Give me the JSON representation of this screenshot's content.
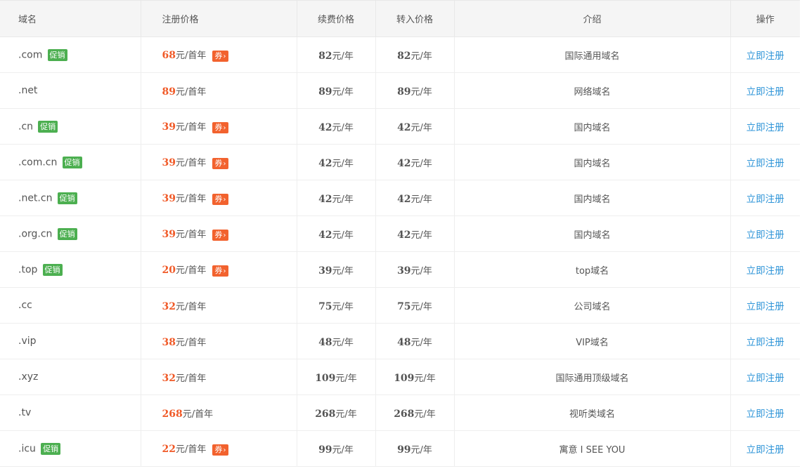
{
  "header": {
    "domain": "域名",
    "register_price": "注册价格",
    "renew_price": "续费价格",
    "transfer_price": "转入价格",
    "intro": "介绍",
    "action": "操作"
  },
  "labels": {
    "promo": "促销",
    "coupon": "券",
    "coupon_arrow": "›",
    "first_year_unit": "元/首年",
    "year_unit": "元/年",
    "register_now": "立即注册"
  },
  "rows": [
    {
      "domain": ".com",
      "promo": true,
      "reg": "68",
      "coupon": true,
      "renew": "82",
      "transfer": "82",
      "desc": "国际通用域名"
    },
    {
      "domain": ".net",
      "promo": false,
      "reg": "89",
      "coupon": false,
      "renew": "89",
      "transfer": "89",
      "desc": "网络域名"
    },
    {
      "domain": ".cn",
      "promo": true,
      "reg": "39",
      "coupon": true,
      "renew": "42",
      "transfer": "42",
      "desc": "国内域名"
    },
    {
      "domain": ".com.cn",
      "promo": true,
      "reg": "39",
      "coupon": true,
      "renew": "42",
      "transfer": "42",
      "desc": "国内域名"
    },
    {
      "domain": ".net.cn",
      "promo": true,
      "reg": "39",
      "coupon": true,
      "renew": "42",
      "transfer": "42",
      "desc": "国内域名"
    },
    {
      "domain": ".org.cn",
      "promo": true,
      "reg": "39",
      "coupon": true,
      "renew": "42",
      "transfer": "42",
      "desc": "国内域名"
    },
    {
      "domain": ".top",
      "promo": true,
      "reg": "20",
      "coupon": true,
      "renew": "39",
      "transfer": "39",
      "desc": "top域名"
    },
    {
      "domain": ".cc",
      "promo": false,
      "reg": "32",
      "coupon": false,
      "renew": "75",
      "transfer": "75",
      "desc": "公司域名"
    },
    {
      "domain": ".vip",
      "promo": false,
      "reg": "38",
      "coupon": false,
      "renew": "48",
      "transfer": "48",
      "desc": "VIP域名"
    },
    {
      "domain": ".xyz",
      "promo": false,
      "reg": "32",
      "coupon": false,
      "renew": "109",
      "transfer": "109",
      "desc": "国际通用顶级域名"
    },
    {
      "domain": ".tv",
      "promo": false,
      "reg": "268",
      "coupon": false,
      "renew": "268",
      "transfer": "268",
      "desc": "视听类域名"
    },
    {
      "domain": ".icu",
      "promo": true,
      "reg": "22",
      "coupon": true,
      "renew": "99",
      "transfer": "99",
      "desc": "寓意 I SEE YOU"
    }
  ],
  "colors": {
    "accent_price": "#f05a28",
    "promo_badge": "#4caf50",
    "coupon_badge": "#f2622e",
    "link": "#2f95d8",
    "header_bg": "#f5f5f5"
  }
}
